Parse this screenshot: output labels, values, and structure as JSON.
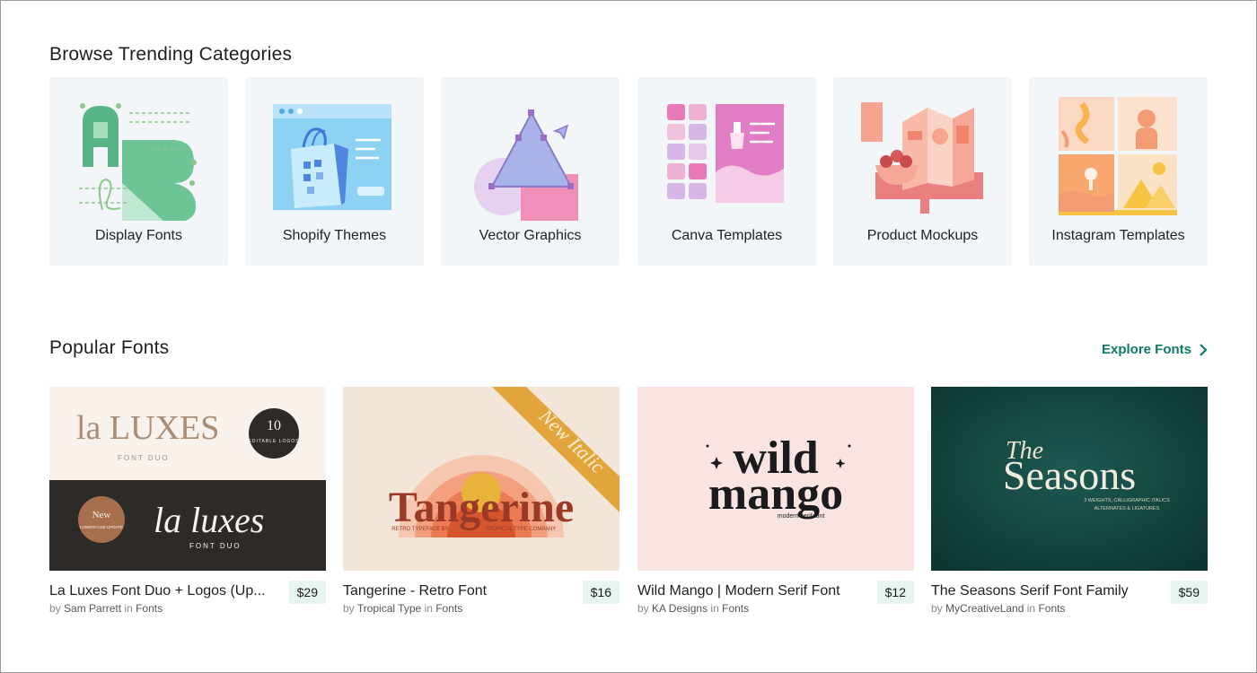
{
  "trending": {
    "title": "Browse Trending Categories",
    "categories": [
      {
        "label": "Display Fonts",
        "icon": "display-fonts-illustration"
      },
      {
        "label": "Shopify Themes",
        "icon": "shopify-themes-illustration"
      },
      {
        "label": "Vector Graphics",
        "icon": "vector-graphics-illustration"
      },
      {
        "label": "Canva Templates",
        "icon": "canva-templates-illustration"
      },
      {
        "label": "Product Mockups",
        "icon": "product-mockups-illustration"
      },
      {
        "label": "Instagram Templates",
        "icon": "instagram-templates-illustration"
      }
    ]
  },
  "popular": {
    "title": "Popular Fonts",
    "explore_label": "Explore Fonts",
    "items": [
      {
        "title": "La Luxes Font Duo + Logos (Up...",
        "price": "$29",
        "by": "by",
        "author": "Sam Parrett",
        "in": "in",
        "category": "Fonts",
        "thumb": {
          "logo_top": "la LUXES",
          "sub_top": "FONT DUO",
          "badge_num": "10",
          "badge_text": "EDITABLE LOGOS",
          "logo_bottom": "la luxes",
          "sub_bottom": "FONT DUO",
          "badge2_top": "New",
          "badge2_text": "LOWERCASE UPDATE"
        }
      },
      {
        "title": "Tangerine - Retro Font",
        "price": "$16",
        "by": "by",
        "author": "Tropical Type",
        "in": "in",
        "category": "Fonts",
        "thumb": {
          "word": "Tangerine",
          "ribbon": "New Italic",
          "sub_left": "RETRO TYPEFACE BY",
          "sub_right": "TROPICAL TYPE COMPANY"
        }
      },
      {
        "title": "Wild Mango | Modern Serif Font",
        "price": "$12",
        "by": "by",
        "author": "KA Designs",
        "in": "in",
        "category": "Fonts",
        "thumb": {
          "line1": "wild",
          "line2": "mango",
          "sub": "modern serif font"
        }
      },
      {
        "title": "The Seasons Serif Font Family",
        "price": "$59",
        "by": "by",
        "author": "MyCreativeLand",
        "in": "in",
        "category": "Fonts",
        "thumb": {
          "line1": "The",
          "line2": "Seasons",
          "sub1": "3 WEIGHTS, CALLIGRAPHIC ITALICS",
          "sub2": "ALTERNATES & LIGATURES"
        }
      }
    ]
  },
  "colors": {
    "accent": "#0e7a67",
    "card_bg": "#f3f6f9",
    "price_bg": "#e5f5f2"
  }
}
